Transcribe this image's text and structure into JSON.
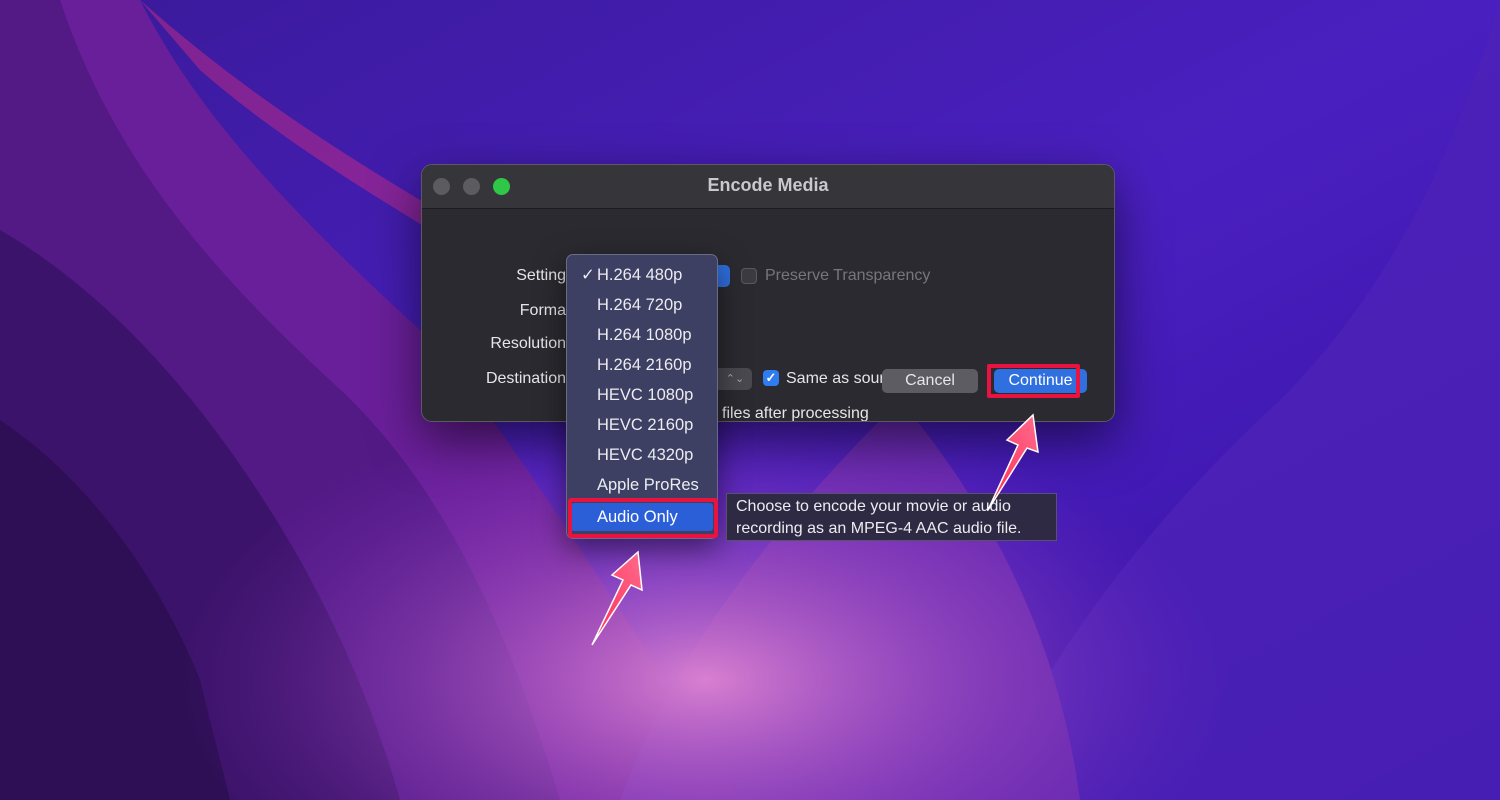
{
  "colors": {
    "dialog_bg": "#2b2a30",
    "menu_bg": "#3d3f63",
    "accent": "#2f6fe0",
    "annotation_red": "#e8133f",
    "zoom_green": "#2fc748"
  },
  "dialog": {
    "title": "Encode Media",
    "labels": {
      "settings": "Setting",
      "format": "Forma",
      "resolution": "Resolution",
      "destination": "Destination"
    },
    "preserve_transparency": {
      "label": "Preserve Transparency",
      "checked": false
    },
    "same_as_source": {
      "label": "Same as source file",
      "checked": true
    },
    "delete_label": "files after processing",
    "buttons": {
      "cancel": "Cancel",
      "continue": "Continue"
    }
  },
  "menu": {
    "selected_check": "✓",
    "items": [
      {
        "label": "H.264 480p",
        "checked": true
      },
      {
        "label": "H.264 720p"
      },
      {
        "label": "H.264 1080p"
      },
      {
        "label": "H.264 2160p"
      },
      {
        "label": "HEVC 1080p"
      },
      {
        "label": "HEVC 2160p"
      },
      {
        "label": "HEVC 4320p"
      },
      {
        "label": "Apple ProRes"
      },
      {
        "label": "Audio Only",
        "highlighted": true
      }
    ]
  },
  "tooltip": {
    "line1": "Choose to encode your movie or audio",
    "line2": "recording as an MPEG-4 AAC audio file."
  },
  "icons": {
    "close": "close-icon",
    "minimize": "minimize-icon",
    "zoom": "zoom-icon",
    "checkmark": "checkmark-icon",
    "pointer_arrow": "arrow-annotation-icon"
  }
}
